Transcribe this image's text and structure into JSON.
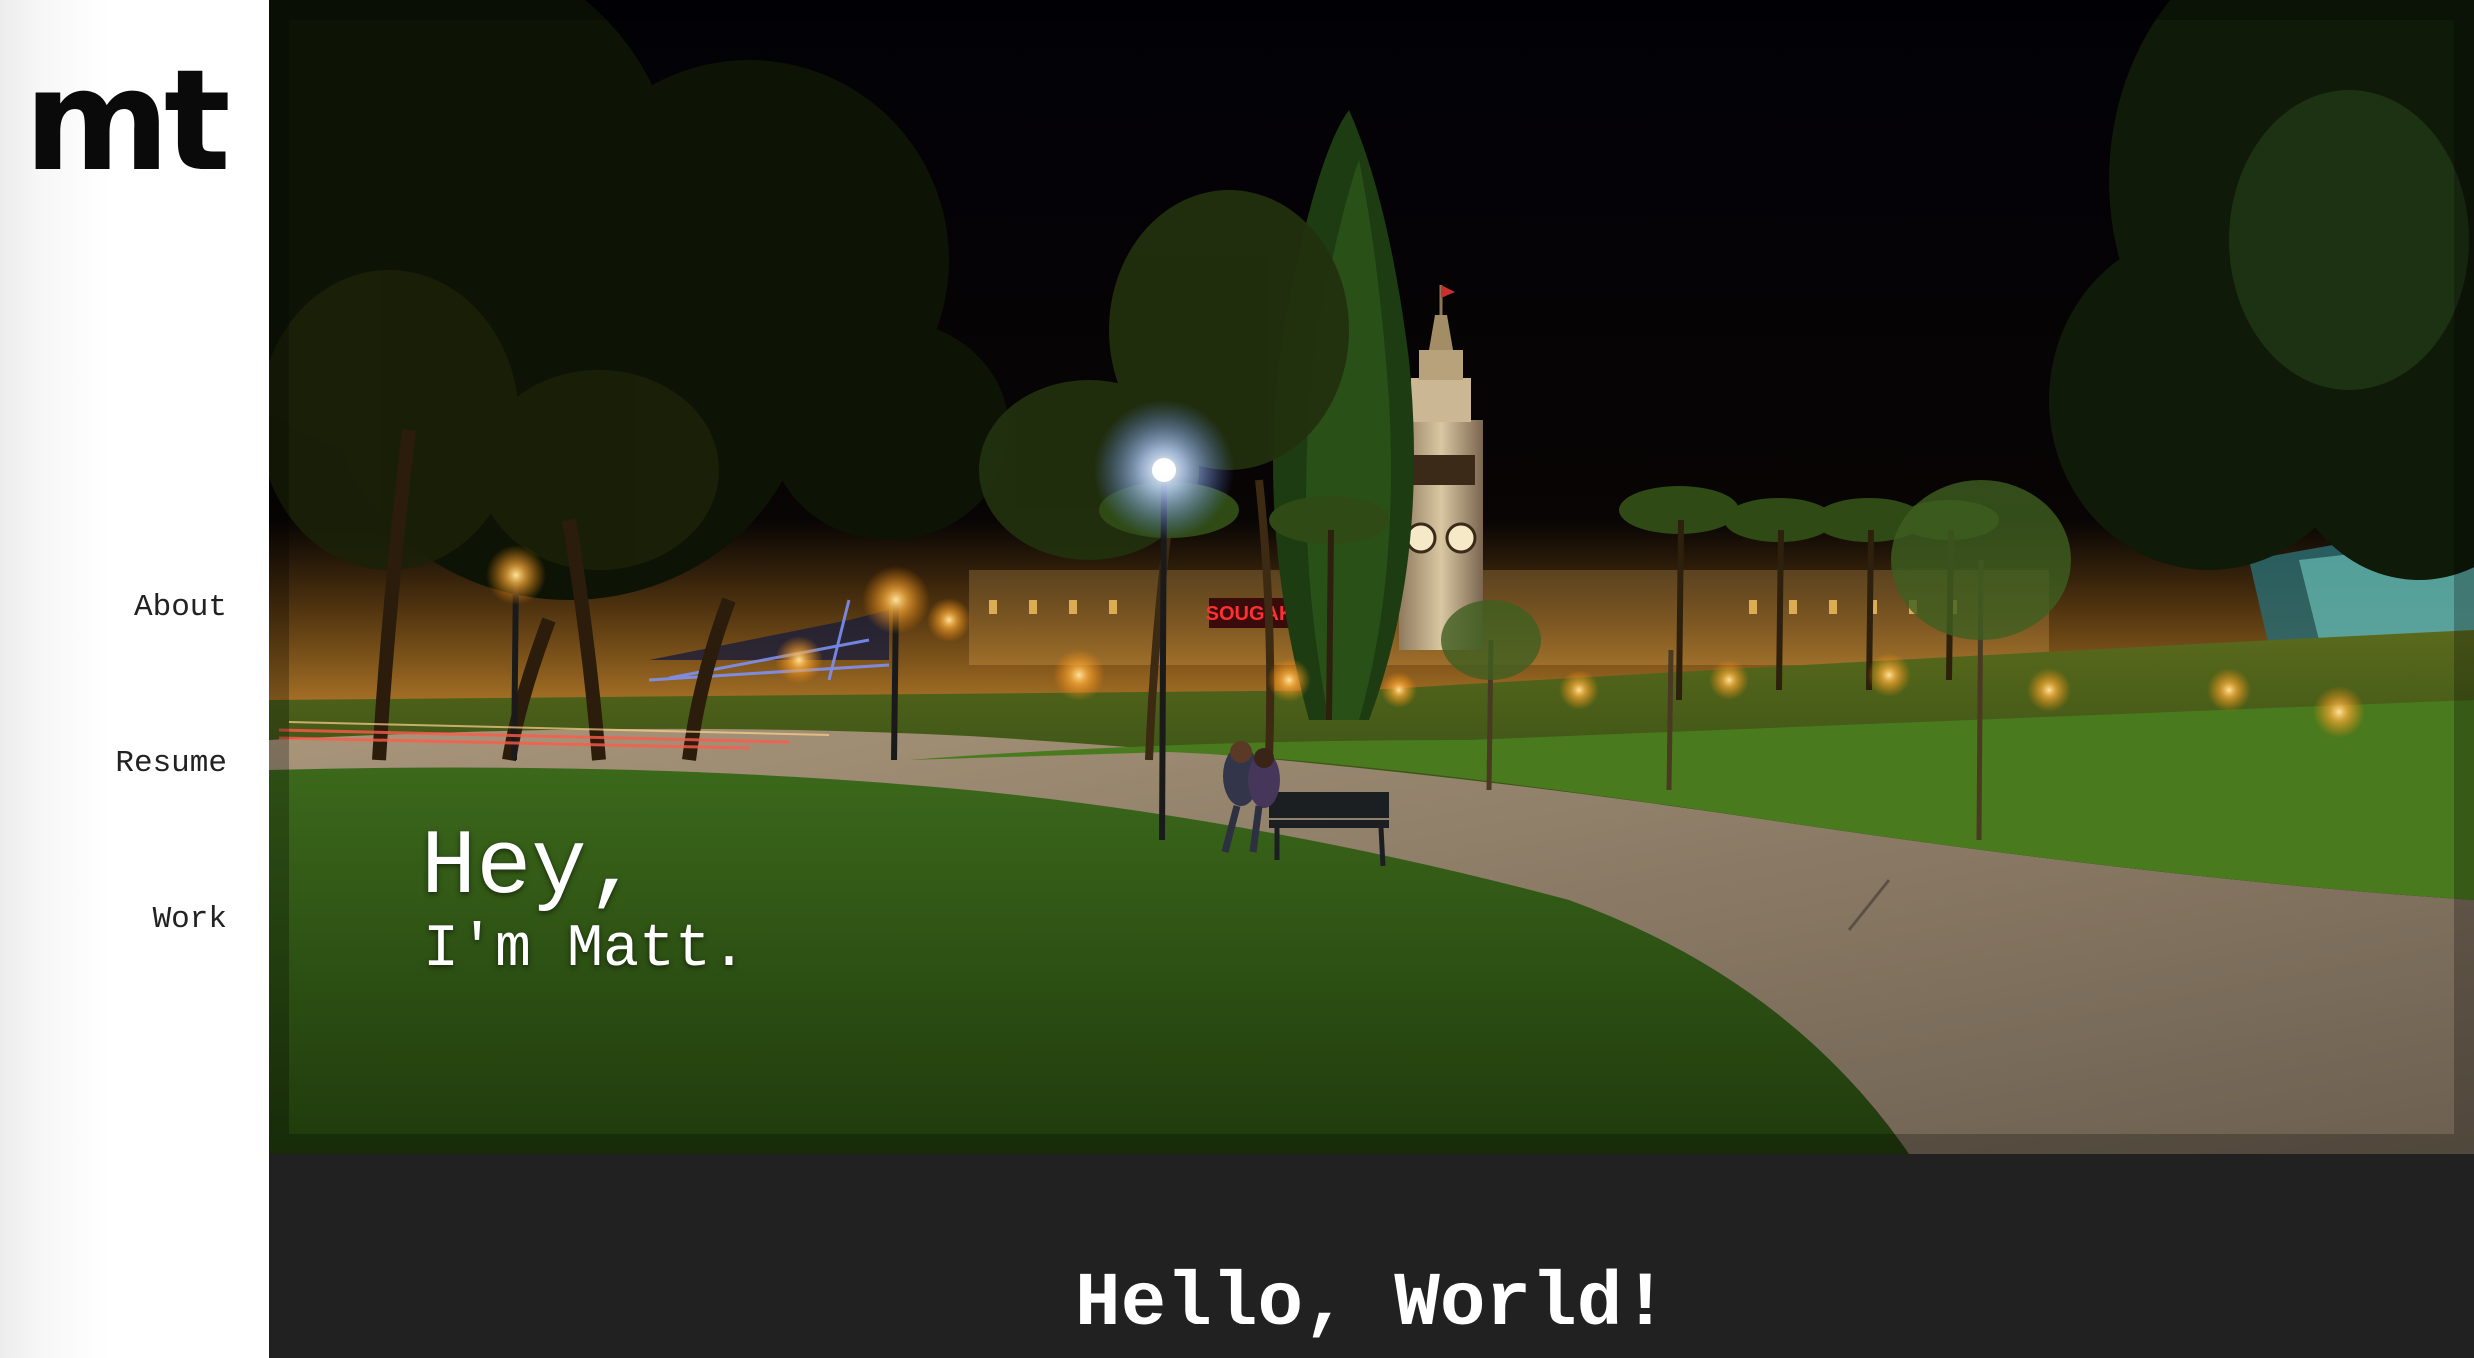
{
  "sidebar": {
    "logo": "mt",
    "nav": [
      {
        "label": "About"
      },
      {
        "label": "Resume"
      },
      {
        "label": "Work"
      }
    ]
  },
  "hero": {
    "greeting": "Hey,",
    "name_line": "I'm Matt.",
    "sign_text": "SOUGAKAR"
  },
  "main": {
    "heading": "Hello, World!"
  },
  "colors": {
    "sidebar_bg": "#ffffff",
    "dark_section_bg": "#212121",
    "text_light": "#ffffff",
    "text_dark": "#222222"
  }
}
